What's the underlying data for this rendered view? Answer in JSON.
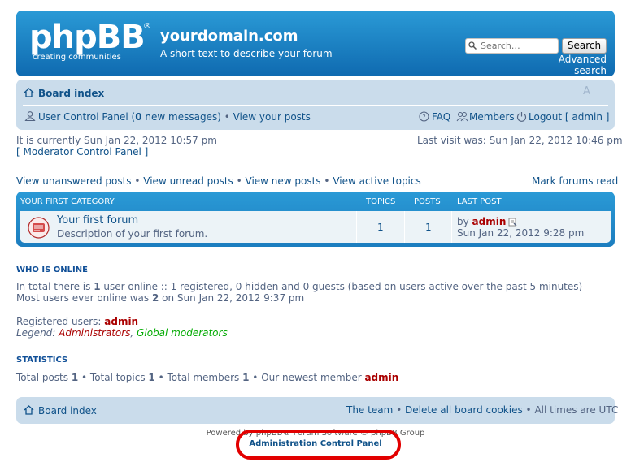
{
  "header": {
    "logo_text": "phpBB",
    "logo_reg": "®",
    "logo_tagline": "creating communities",
    "site_title": "yourdomain.com",
    "site_description": "A short text to describe your forum",
    "search_placeholder": "Search…",
    "search_button": "Search",
    "advanced_search": "Advanced search"
  },
  "navbar": {
    "board_index": "Board index",
    "font_resize": "A",
    "ucp": "User Control Panel (",
    "new_messages_count": "0",
    "new_messages_suffix": " new messages)",
    "bullet": " • ",
    "view_posts": "View your posts",
    "faq": "FAQ",
    "members": "Members",
    "logout": "Logout [ admin ]"
  },
  "status": {
    "current_time": "It is currently Sun Jan 22, 2012 10:57 pm",
    "mcp": "[ Moderator Control Panel ]",
    "last_visit": "Last visit was: Sun Jan 22, 2012 10:46 pm"
  },
  "links": {
    "unanswered": "View unanswered posts",
    "unread": "View unread posts",
    "new_posts": "View new posts",
    "active": "View active topics",
    "mark_read": "Mark forums read"
  },
  "forum_table": {
    "category": "YOUR FIRST CATEGORY",
    "col_topics": "TOPICS",
    "col_posts": "POSTS",
    "col_last_post": "LAST POST",
    "rows": [
      {
        "name": "Your first forum",
        "description": "Description of your first forum.",
        "topics": "1",
        "posts": "1",
        "last_by": "by ",
        "last_author": "admin",
        "last_date": "Sun Jan 22, 2012 9:28 pm"
      }
    ]
  },
  "who_is_online": {
    "heading": "WHO IS ONLINE",
    "line1_pre": "In total there is ",
    "line1_count": "1",
    "line1_post": " user online :: 1 registered, 0 hidden and 0 guests (based on users active over the past 5 minutes)",
    "line2_pre": "Most users ever online was ",
    "line2_count": "2",
    "line2_post": " on Sun Jan 22, 2012 9:37 pm",
    "registered_label": "Registered users: ",
    "registered_user": "admin",
    "legend_label": "Legend: ",
    "legend_admins": "Administrators",
    "legend_sep": ", ",
    "legend_globalmods": "Global moderators"
  },
  "statistics": {
    "heading": "STATISTICS",
    "posts_label": "Total posts ",
    "posts": "1",
    "topics_label": "Total topics ",
    "topics": "1",
    "members_label": "Total members ",
    "members": "1",
    "newest_label": "Our newest member ",
    "newest": "admin",
    "sep": " • "
  },
  "footer": {
    "board_index": "Board index",
    "team": "The team",
    "delete_cookies": "Delete all board cookies",
    "timezone": "All times are UTC",
    "sep": " • ",
    "powered": "Powered by phpBB® Forum Software © phpBB Group",
    "acp": "Administration Control Panel"
  },
  "colors": {
    "header_blue": "#1e82c6",
    "navbar_bg": "#cadceb",
    "row_bg": "#ecf3f7",
    "admin_red": "#aa0000",
    "global_mod_green": "#00aa00",
    "highlight_red": "#e20000"
  }
}
